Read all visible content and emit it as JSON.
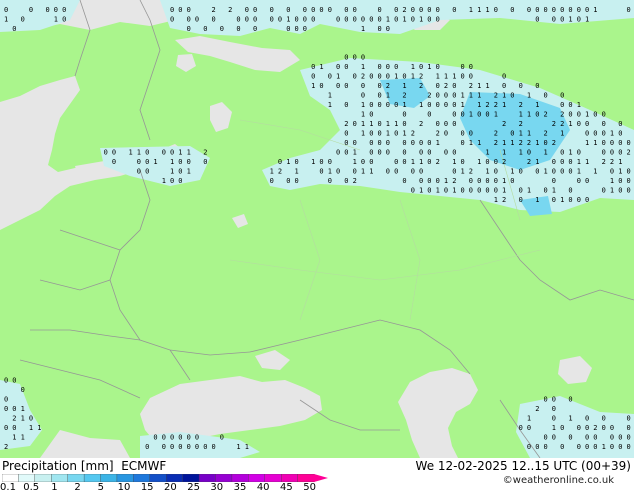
{
  "header": {
    "title_left": "Precipitation [mm]",
    "model": "ECMWF",
    "valid_time": "We 12-02-2025 12..15 UTC (00+39)",
    "credit": "©weatheronline.co.uk"
  },
  "legend": {
    "colors": [
      "#ffffff",
      "#e1fafa",
      "#c8f0f0",
      "#a0e6f0",
      "#78d7f0",
      "#55c8f0",
      "#3cb4e6",
      "#2896e1",
      "#1e78dc",
      "#1450c8",
      "#0a2db4",
      "#00149b",
      "#7800c8",
      "#9600d2",
      "#b400dc",
      "#d200e6",
      "#e600d2",
      "#f000b4",
      "#ff0096"
    ],
    "ticks": [
      {
        "label": "0.1",
        "pos": 0
      },
      {
        "label": "0.5",
        "pos": 1
      },
      {
        "label": "1",
        "pos": 2
      },
      {
        "label": "2",
        "pos": 3
      },
      {
        "label": "5",
        "pos": 4
      },
      {
        "label": "10",
        "pos": 5
      },
      {
        "label": "15",
        "pos": 6
      },
      {
        "label": "20",
        "pos": 7
      },
      {
        "label": "25",
        "pos": 8
      },
      {
        "label": "30",
        "pos": 9
      },
      {
        "label": "35",
        "pos": 10
      },
      {
        "label": "40",
        "pos": 11
      },
      {
        "label": "45",
        "pos": 12
      },
      {
        "label": "50",
        "pos": 13
      }
    ]
  },
  "map": {
    "land_color": "#aaf58c",
    "water_color": "#e6e6e6",
    "border_color": "#969696",
    "precip_light_color": "#c8f0f0",
    "precip_mid_color": "#78d7f0",
    "value_labels": [
      "0",
      "1",
      "2",
      "3"
    ]
  }
}
